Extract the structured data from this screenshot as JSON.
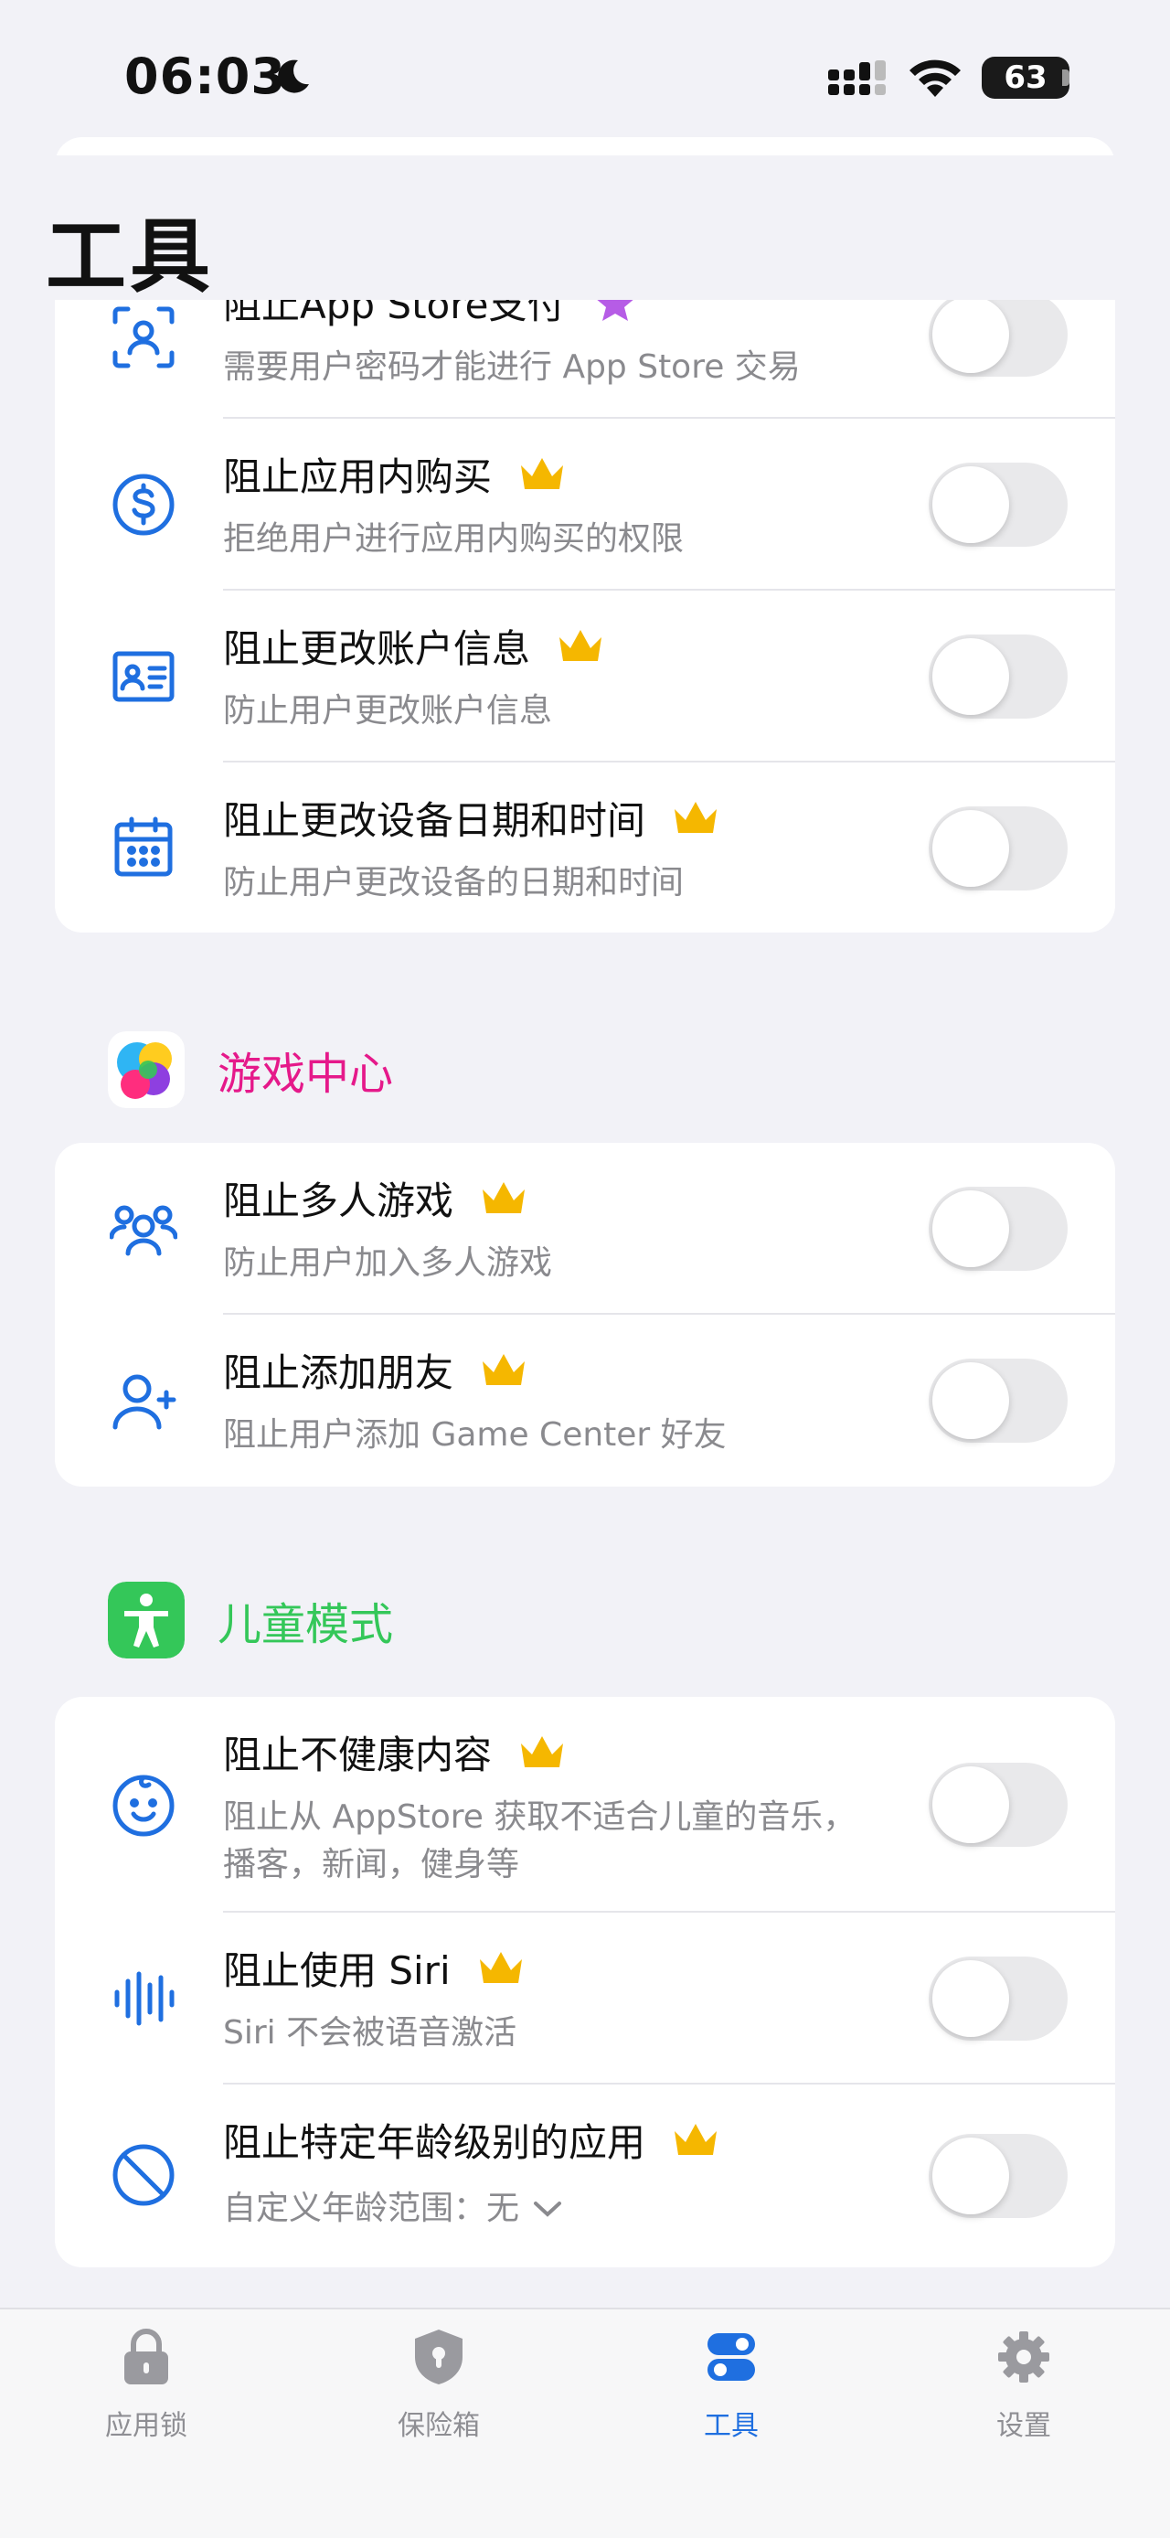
{
  "status": {
    "time": "06:03",
    "battery": "63"
  },
  "page": {
    "title": "工具"
  },
  "sections": {
    "appstore": {
      "items": [
        {
          "title": "阻止App Store支付",
          "subtitle": "需要用户密码才能进行 App Store 交易",
          "badge": "star-icon",
          "toggle": false
        },
        {
          "title": "阻止应用内购买",
          "subtitle": "拒绝用户进行应用内购买的权限",
          "badge": "crown-icon",
          "toggle": false
        },
        {
          "title": "阻止更改账户信息",
          "subtitle": "防止用户更改账户信息",
          "badge": "crown-icon",
          "toggle": false
        },
        {
          "title": "阻止更改设备日期和时间",
          "subtitle": "防止用户更改设备的日期和时间",
          "badge": "crown-icon",
          "toggle": false
        }
      ]
    },
    "gamecenter": {
      "label": "游戏中心",
      "label_color": "#e5198a",
      "items": [
        {
          "title": "阻止多人游戏",
          "subtitle": "防止用户加入多人游戏",
          "toggle": false
        },
        {
          "title": "阻止添加朋友",
          "subtitle": "阻止用户添加 Game Center 好友",
          "toggle": false
        }
      ]
    },
    "kids": {
      "label": "儿童模式",
      "label_color": "#34c759",
      "items": [
        {
          "title": "阻止不健康内容",
          "subtitle_line1": "阻止从 AppStore 获取不适合儿童的音乐，",
          "subtitle_line2": "播客，新闻，健身等",
          "toggle": false
        },
        {
          "title": "阻止使用 Siri",
          "subtitle": "Siri 不会被语音激活",
          "toggle": false
        },
        {
          "title": "阻止特定年龄级别的应用",
          "subtitle": "自定义年龄范围：无",
          "toggle": false
        }
      ]
    }
  },
  "tabbar": {
    "active": "tools",
    "accent": "#1f6fe0",
    "tabs": [
      {
        "label": "应用锁"
      },
      {
        "label": "保险箱"
      },
      {
        "label": "工具"
      },
      {
        "label": "设置"
      }
    ]
  }
}
